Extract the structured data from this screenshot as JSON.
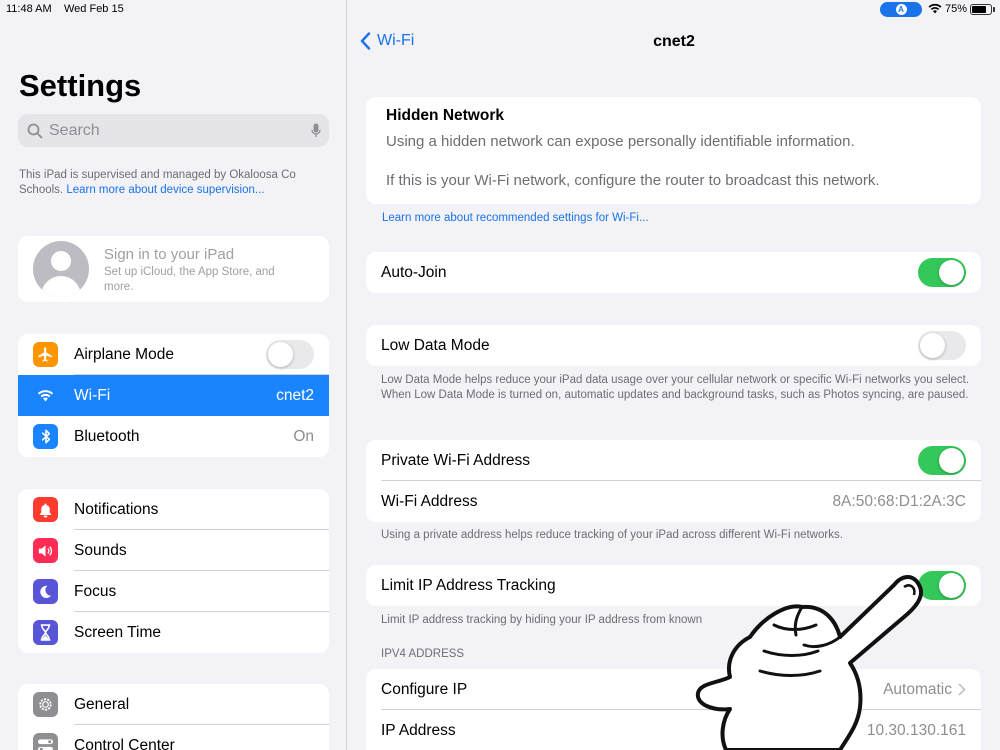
{
  "status_bar": {
    "time": "11:48 AM",
    "date": "Wed Feb 15",
    "battery": "75%",
    "battery_level": 0.75
  },
  "sidebar": {
    "title": "Settings",
    "search_placeholder": "Search",
    "supervision_text": "This iPad is supervised and managed by Okaloosa Co Schools. ",
    "supervision_link": "Learn more about device supervision...",
    "account": {
      "title": "Sign in to your iPad",
      "subtitle": "Set up iCloud, the App Store, and more."
    },
    "connectivity": [
      {
        "label": "Airplane Mode",
        "icon": "airplane-icon",
        "color": "#ff9500",
        "toggle": false
      },
      {
        "label": "Wi-Fi",
        "value": "cnet2",
        "icon": "wifi-icon",
        "color": "#1a84ff",
        "active": true
      },
      {
        "label": "Bluetooth",
        "value": "On",
        "icon": "bluetooth-icon",
        "color": "#1a84ff"
      }
    ],
    "notifications_group": [
      {
        "label": "Notifications",
        "icon": "bell-icon",
        "color": "#ff3b30"
      },
      {
        "label": "Sounds",
        "icon": "speaker-icon",
        "color": "#ff2d55"
      },
      {
        "label": "Focus",
        "icon": "moon-icon",
        "color": "#5856d6"
      },
      {
        "label": "Screen Time",
        "icon": "hourglass-icon",
        "color": "#5856d6"
      }
    ],
    "general_group": [
      {
        "label": "General",
        "icon": "gear-icon",
        "color": "#8e8e93"
      },
      {
        "label": "Control Center",
        "icon": "switches-icon",
        "color": "#8e8e93"
      }
    ]
  },
  "detail": {
    "back_label": "Wi-Fi",
    "title": "cnet2",
    "hidden_network": {
      "heading": "Hidden Network",
      "line1": "Using a hidden network can expose personally identifiable information.",
      "line2": "If this is your Wi-Fi network, configure the router to broadcast this network."
    },
    "recommended_link": "Learn more about recommended settings for Wi-Fi...",
    "auto_join": {
      "label": "Auto-Join",
      "on": true
    },
    "low_data": {
      "label": "Low Data Mode",
      "on": false,
      "footer": "Low Data Mode helps reduce your iPad data usage over your cellular network or specific Wi-Fi networks you select. When Low Data Mode is turned on, automatic updates and background tasks, such as Photos syncing, are paused."
    },
    "private_address": {
      "label": "Private Wi-Fi Address",
      "on": true,
      "address_label": "Wi-Fi Address",
      "address_value": "8A:50:68:D1:2A:3C",
      "footer": "Using a private address helps reduce tracking of your iPad across different Wi-Fi networks."
    },
    "limit_ip": {
      "label": "Limit IP Address Tracking",
      "on": true,
      "footer": "Limit IP address tracking by hiding your IP address from known"
    },
    "ipv4": {
      "header": "IPV4 ADDRESS",
      "configure_label": "Configure IP",
      "configure_value": "Automatic",
      "ip_label": "IP Address",
      "ip_value": "10.30.130.161"
    }
  }
}
